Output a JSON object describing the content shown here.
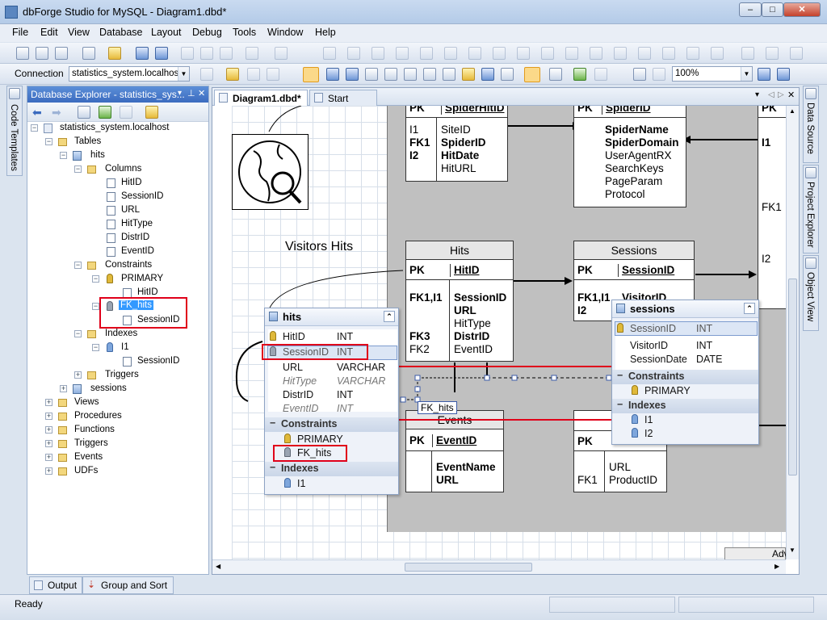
{
  "window": {
    "title": "dbForge Studio for MySQL - Diagram1.dbd*",
    "min": "–",
    "max": "□",
    "close": "✕"
  },
  "menu": [
    "File",
    "Edit",
    "View",
    "Database",
    "Layout",
    "Debug",
    "Tools",
    "Window",
    "Help"
  ],
  "connection": {
    "label": "Connection",
    "value": "statistics_system.localhost"
  },
  "zoom": "100%",
  "left_tab": "Code Templates",
  "explorer": {
    "title": "Database Explorer - statistics_sys...",
    "tree": {
      "server": "statistics_system.localhost",
      "tables": "Tables",
      "hits": "hits",
      "columns": "Columns",
      "cols": [
        "HitID",
        "SessionID",
        "URL",
        "HitType",
        "DistrID",
        "EventID"
      ],
      "constraints": "Constraints",
      "primary": "PRIMARY",
      "primary_col": "HitID",
      "fk": "FK_hits",
      "fk_col": "SessionID",
      "indexes": "Indexes",
      "idx": "I1",
      "idx_col": "SessionID",
      "triggers": "Triggers",
      "sessions": "sessions",
      "top": [
        "Views",
        "Procedures",
        "Functions",
        "Triggers",
        "Events",
        "UDFs"
      ]
    }
  },
  "bottom_tabs": [
    "Output",
    "Group and Sort"
  ],
  "status": "Ready",
  "doc_tabs": [
    "Diagram1.dbd*",
    "Start Page"
  ],
  "right_tabs": [
    "Data Source",
    "Project Explorer",
    "Object View"
  ],
  "diagram": {
    "note_visitors": "Visitors Hits",
    "spiderhit": {
      "pk": "PK",
      "pk_name": "SpiderHitID",
      "keys": [
        "I1",
        "FK1",
        "I2"
      ],
      "cols": [
        "SiteID",
        "SpiderID",
        "HitDate",
        "HitURL"
      ]
    },
    "spider": {
      "pk": "PK",
      "pk_name": "SpiderID",
      "cols": [
        "SpiderName",
        "SpiderDomain",
        "UserAgentRX",
        "SearchKeys",
        "PageParam",
        "Protocol"
      ]
    },
    "partial": {
      "pk": "PK",
      "keys": [
        "I1",
        "FK1",
        "I2"
      ]
    },
    "hits": {
      "name": "Hits",
      "pk": "PK",
      "pk_name": "HitID",
      "keys": [
        "FK1,I1",
        "",
        "",
        "FK3",
        "FK2"
      ],
      "cols": [
        "SessionID",
        "URL",
        "HitType",
        "DistrID",
        "EventID"
      ]
    },
    "sessions": {
      "name": "Sessions",
      "pk": "PK",
      "pk_name": "SessionID",
      "keys": [
        "FK1,I1",
        "I2"
      ],
      "cols": [
        "VisitorID"
      ]
    },
    "events": {
      "name": "Events",
      "pk": "PK",
      "pk_name": "EventID",
      "cols": [
        "EventName",
        "URL"
      ]
    },
    "urls": {
      "pk": "PK",
      "keys": [
        "",
        "FK1"
      ],
      "cols": [
        "URL",
        "ProductID"
      ]
    },
    "fk_label": "FK_hits",
    "adv": "Adv"
  },
  "hits_popup": {
    "title": "hits",
    "rows": [
      [
        "HitID",
        "INT"
      ],
      [
        "SessionID",
        "INT"
      ],
      [
        "URL",
        "VARCHAR"
      ],
      [
        "HitType",
        "VARCHAR"
      ],
      [
        "DistrID",
        "INT"
      ],
      [
        "EventID",
        "INT"
      ]
    ],
    "constraints": "Constraints",
    "c_items": [
      "PRIMARY",
      "FK_hits"
    ],
    "indexes": "Indexes",
    "i_items": [
      "I1"
    ]
  },
  "sessions_popup": {
    "title": "sessions",
    "rows": [
      [
        "SessionID",
        "INT"
      ],
      [
        "VisitorID",
        "INT"
      ],
      [
        "SessionDate",
        "DATE"
      ]
    ],
    "constraints": "Constraints",
    "c_items": [
      "PRIMARY"
    ],
    "indexes": "Indexes",
    "i_items": [
      "I1",
      "I2"
    ]
  }
}
